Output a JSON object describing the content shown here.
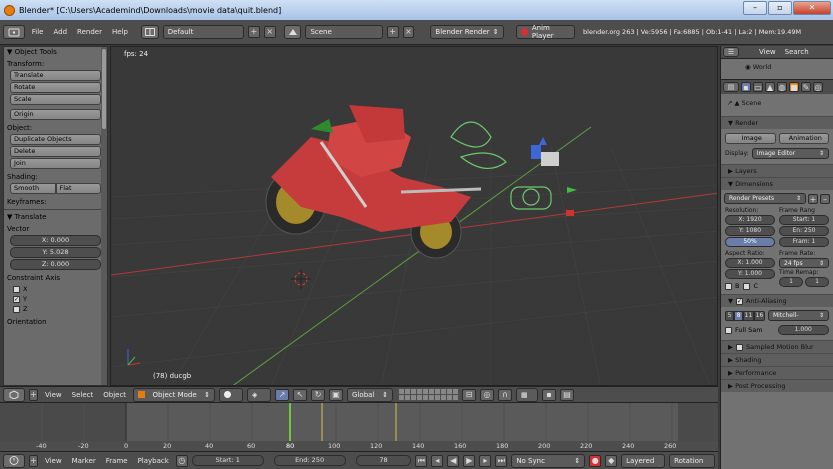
{
  "window": {
    "title": "Blender* [C:\\Users\\Academind\\Downloads\\movie data\\quit.blend]",
    "minimize": "–",
    "maximize": "▫",
    "close": "✕"
  },
  "infobar": {
    "menus": [
      "File",
      "Add",
      "Render",
      "Help"
    ],
    "layout": "Default",
    "scene": "Scene",
    "engine": "Blender Render",
    "anim_player": "Anim Player",
    "stats": "blender.org 263 | Ve:5956 | Fa:6885 | Ob:1-41 | La:2 | Mem:19.49M"
  },
  "toolshelf": {
    "title": "Object Tools",
    "transform_label": "Transform:",
    "transform_buttons": [
      "Translate",
      "Rotate",
      "Scale"
    ],
    "origin": "Origin",
    "object_label": "Object:",
    "object_buttons": [
      "Duplicate Objects",
      "Delete",
      "Join"
    ],
    "shading_label": "Shading:",
    "smooth": "Smooth",
    "flat": "Flat",
    "keyframes_label": "Keyframes:",
    "operator_title": "Translate",
    "vector_label": "Vector",
    "vector": [
      "X: 0.000",
      "Y: 5.028",
      "Z: 0.000"
    ],
    "constraint_label": "Constraint Axis",
    "axes": [
      {
        "label": "X",
        "checked": false
      },
      {
        "label": "Y",
        "checked": true
      },
      {
        "label": "Z",
        "checked": false
      }
    ],
    "orientation_label": "Orientation"
  },
  "viewport": {
    "fps": "fps: 24",
    "frame_object": "(78) ducgb"
  },
  "view3d_header": {
    "menus": [
      "View",
      "Select",
      "Object"
    ],
    "mode": "Object Mode",
    "orientation": "Global"
  },
  "timeline": {
    "ticks": [
      "-40",
      "-20",
      "0",
      "20",
      "40",
      "60",
      "80",
      "100",
      "120",
      "140",
      "160",
      "180",
      "200",
      "220",
      "240",
      "260"
    ],
    "menus": [
      "View",
      "Marker",
      "Frame",
      "Playback"
    ],
    "start": "Start: 1",
    "end": "End: 250",
    "current": "78",
    "sync": "No Sync",
    "keying": "Layered",
    "keyset": "Rotation"
  },
  "properties": {
    "header_menus": [
      "View",
      "Search"
    ],
    "world": "World",
    "scene": "Scene",
    "render_section": "Render",
    "image": "Image",
    "animation": "Animation",
    "display_label": "Display:",
    "display": "Image Editor",
    "layers": "Layers",
    "dimensions": "Dimensions",
    "presets": "Render Presets",
    "resolution_label": "Resolution:",
    "res_x": "X: 1920",
    "res_y": "Y: 1080",
    "res_pct": "50%",
    "frame_range_label": "Frame Rang",
    "start": "Start: 1",
    "end": "En: 250",
    "frame_step": "Fram: 1",
    "aspect_label": "Aspect Ratio:",
    "asp_x": "X: 1.000",
    "asp_y": "Y: 1.000",
    "frame_rate_label": "Frame Rate:",
    "fps": "24 fps",
    "remap_label": "Time Remap:",
    "remap_old": "1",
    "remap_new": "1",
    "border_b": "B",
    "crop_c": "C",
    "aa_section": "Anti-Aliasing",
    "aa_samples": [
      "5",
      "8",
      "11",
      "16"
    ],
    "aa_filter": "Mitchell-",
    "full_sample": "Full Sam",
    "filter_size": "1.000",
    "motion_blur": "Sampled Motion Blur",
    "shading": "Shading",
    "performance": "Performance",
    "post_processing": "Post Processing"
  },
  "colors": {
    "accent": "#e87d0d",
    "frame_line": "#6ec93c",
    "x_axis": "#b33939",
    "y_axis": "#5da23c"
  }
}
